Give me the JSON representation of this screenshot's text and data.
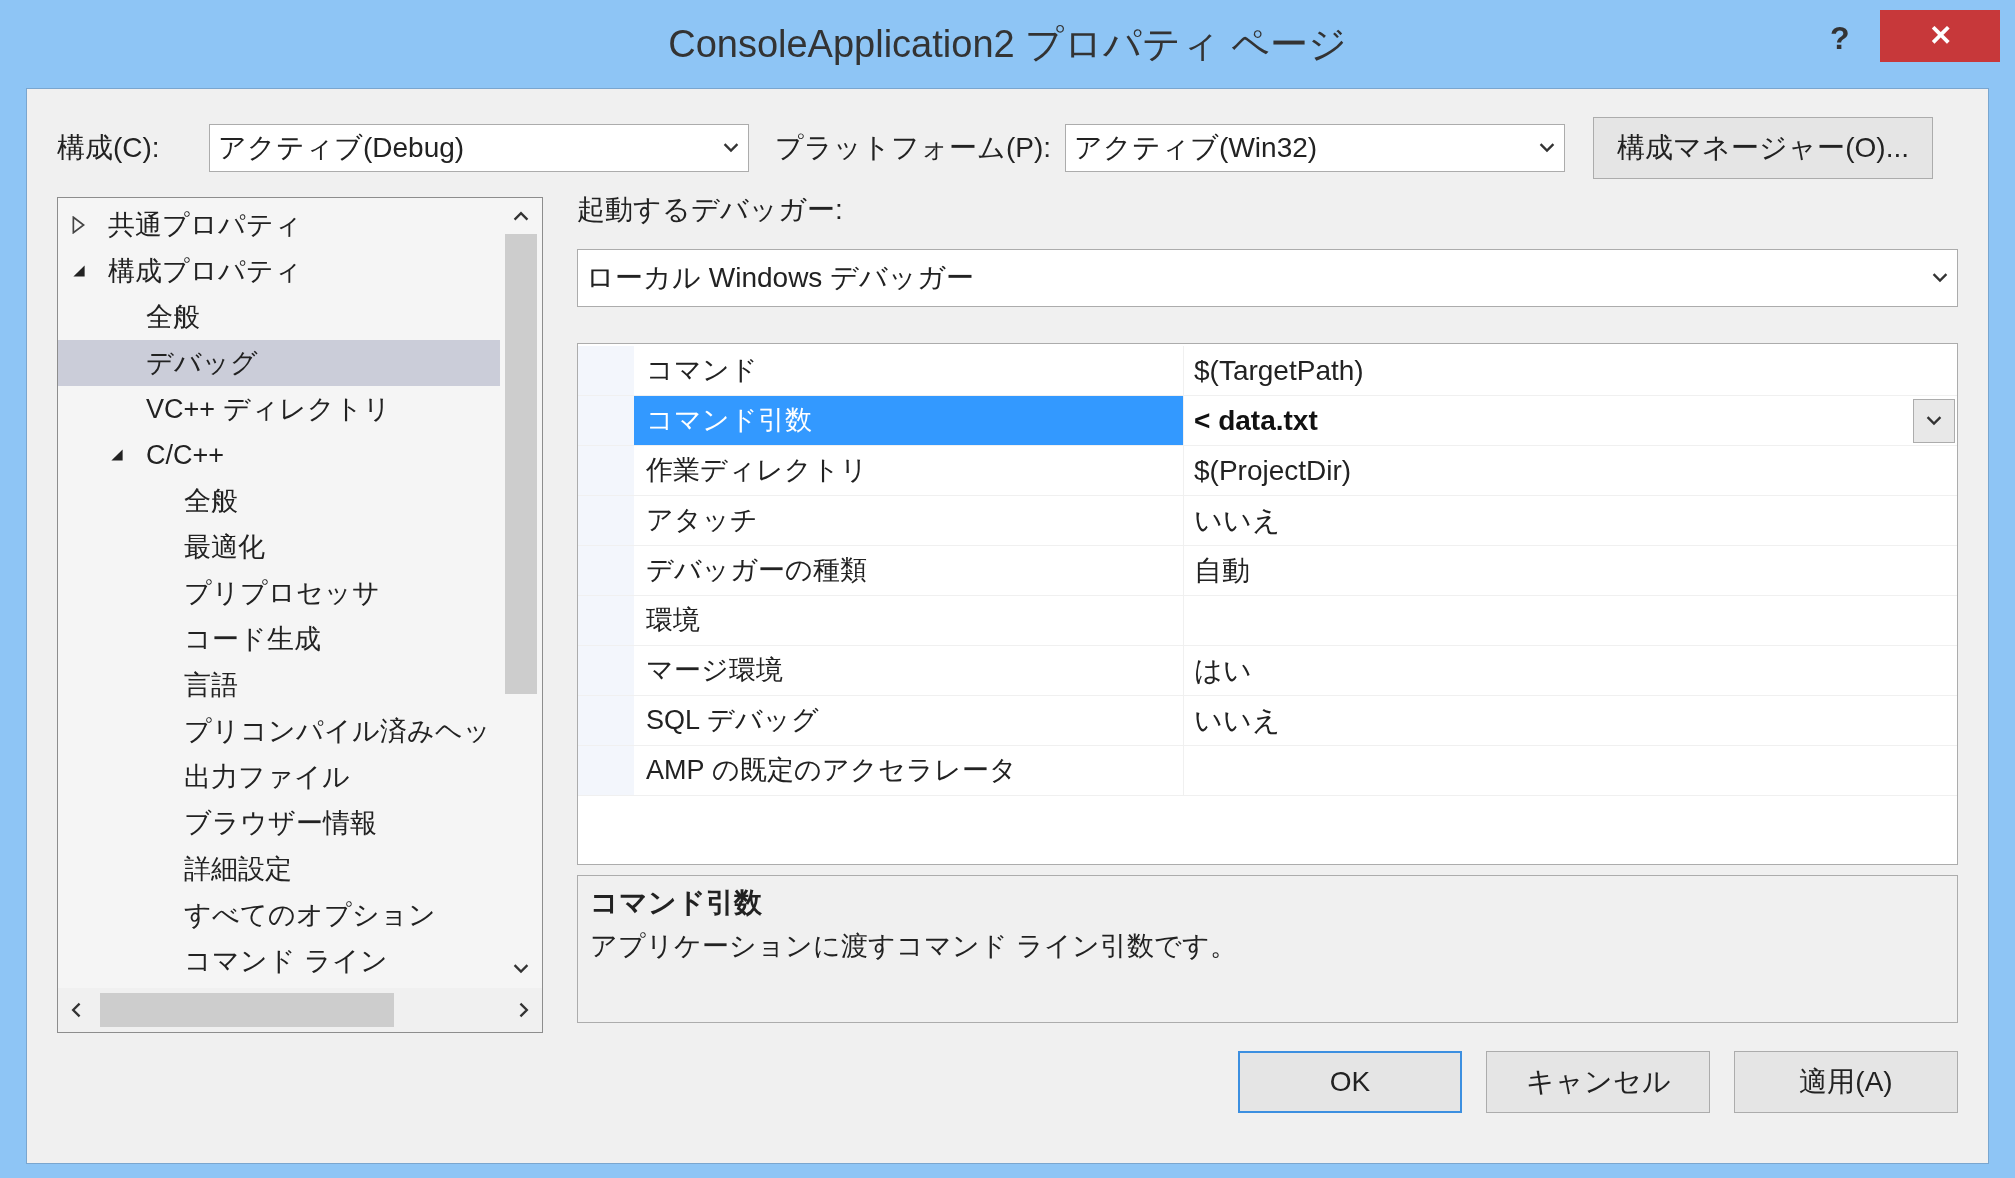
{
  "window": {
    "title": "ConsoleApplication2 プロパティ ページ",
    "help": "?",
    "close": "✕"
  },
  "config_row": {
    "configuration_label": "構成(C):",
    "configuration_value": "アクティブ(Debug)",
    "platform_label": "プラットフォーム(P):",
    "platform_value": "アクティブ(Win32)",
    "manager_button": "構成マネージャー(O)..."
  },
  "tree": [
    {
      "label": "共通プロパティ",
      "expanded": false,
      "selected": false
    },
    {
      "label": "構成プロパティ",
      "expanded": true,
      "selected": false,
      "children": [
        {
          "label": "全般",
          "selected": false
        },
        {
          "label": "デバッグ",
          "selected": true
        },
        {
          "label": "VC++ ディレクトリ",
          "selected": false
        },
        {
          "label": "C/C++",
          "expanded": true,
          "selected": false,
          "children": [
            {
              "label": "全般",
              "selected": false
            },
            {
              "label": "最適化",
              "selected": false
            },
            {
              "label": "プリプロセッサ",
              "selected": false
            },
            {
              "label": "コード生成",
              "selected": false
            },
            {
              "label": "言語",
              "selected": false
            },
            {
              "label": "プリコンパイル済みヘッ",
              "selected": false
            },
            {
              "label": "出力ファイル",
              "selected": false
            },
            {
              "label": "ブラウザー情報",
              "selected": false
            },
            {
              "label": "詳細設定",
              "selected": false
            },
            {
              "label": "すべてのオプション",
              "selected": false
            },
            {
              "label": "コマンド ライン",
              "selected": false
            }
          ]
        }
      ]
    }
  ],
  "debugger": {
    "label": "起動するデバッガー:",
    "value": "ローカル Windows デバッガー"
  },
  "properties": [
    {
      "name": "コマンド",
      "value": "$(TargetPath)",
      "selected": false,
      "modified": false
    },
    {
      "name": "コマンド引数",
      "value": "< data.txt",
      "selected": true,
      "modified": true
    },
    {
      "name": "作業ディレクトリ",
      "value": "$(ProjectDir)",
      "selected": false,
      "modified": false
    },
    {
      "name": "アタッチ",
      "value": "いいえ",
      "selected": false,
      "modified": false
    },
    {
      "name": "デバッガーの種類",
      "value": "自動",
      "selected": false,
      "modified": false
    },
    {
      "name": "環境",
      "selected": false
    },
    {
      "name": "マージ環境",
      "value": "はい",
      "selected": false,
      "modified": false
    },
    {
      "name": "SQL デバッグ",
      "value": "いいえ",
      "selected": false,
      "modified": false
    },
    {
      "name": "AMP の既定のアクセラレータ",
      "selected": false
    }
  ],
  "description": {
    "title": "コマンド引数",
    "text": "アプリケーションに渡すコマンド ライン引数です。"
  },
  "buttons": [
    {
      "label": "OK",
      "default": true
    },
    {
      "label": "キャンセル",
      "default": false
    },
    {
      "label": "適用(A)",
      "default": false
    }
  ]
}
